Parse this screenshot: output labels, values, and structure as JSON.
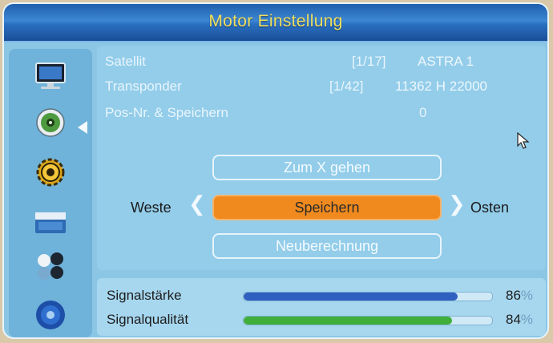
{
  "window": {
    "title": "Motor Einstellung"
  },
  "info": {
    "satellite": {
      "label": "Satellit",
      "index": "[1/17]",
      "value": "ASTRA 1"
    },
    "transponder": {
      "label": "Transponder",
      "index": "[1/42]",
      "value": "11362 H 22000"
    },
    "position": {
      "label": "Pos-Nr. & Speichern",
      "value": "0"
    }
  },
  "buttons": {
    "goto_x": "Zum X gehen",
    "save": "Speichern",
    "recalc": "Neuberechnung"
  },
  "directions": {
    "west": "Weste",
    "east": "Osten"
  },
  "signal": {
    "strength": {
      "label": "Signalstärke",
      "value": "86",
      "unit": "%",
      "level": 0.86,
      "color": "#2f5fbf"
    },
    "quality": {
      "label": "Signalqualität",
      "value": "84",
      "unit": "%",
      "level": 0.84,
      "color": "#3fae3a"
    }
  },
  "sidebar": {
    "icons": [
      "monitor-icon",
      "satellite-dish-icon",
      "settings-icon",
      "folder-icon",
      "media-icon",
      "disc-icon"
    ],
    "selected_index": 1
  },
  "colors": {
    "accent": "#f08a1e",
    "title_text": "#f0e060",
    "background": "#8bc6e4"
  }
}
